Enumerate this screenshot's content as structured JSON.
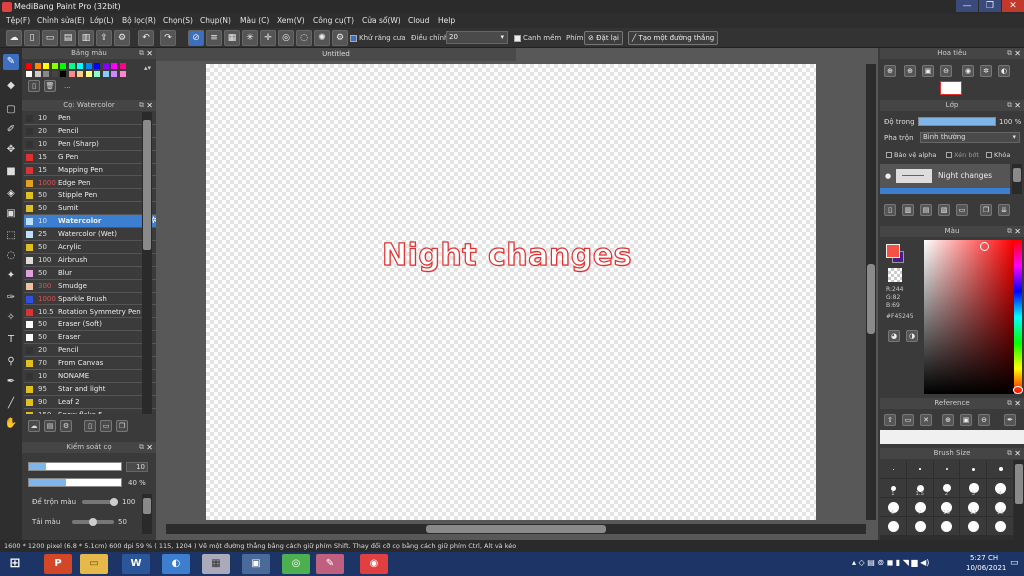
{
  "window": {
    "title": "MediBang Paint Pro (32bit)",
    "controls": [
      "—",
      "❐",
      "✕"
    ]
  },
  "menu": [
    "Tệp(F)",
    "Chỉnh sửa(E)",
    "Lớp(L)",
    "Bộ lọc(R)",
    "Chọn(S)",
    "Chụp(N)",
    "Màu (C)",
    "Xem(V)",
    "Công cụ(T)",
    "Cửa sổ(W)",
    "Cloud",
    "Help"
  ],
  "toolbar": {
    "antialias_label": "Khử răng cưa",
    "adjust_label": "Điều chỉnh",
    "adjust_value": "20",
    "smooth_label": "Canh mềm",
    "key_label": "Phím",
    "reset_label": "Đặt lại",
    "make_line_label": "Tạo một đường thẳng"
  },
  "palette": {
    "title": "Bảng màu",
    "colors": [
      "#ff0000",
      "#ff8800",
      "#ffff00",
      "#88ff00",
      "#00ff00",
      "#00ff88",
      "#00ffff",
      "#0088ff",
      "#0000ff",
      "#8800ff",
      "#ff00ff",
      "#ff0088",
      "#ffffff",
      "#cccccc",
      "#888888",
      "#444444",
      "#000000",
      "#ff8888",
      "#ffcc88",
      "#ffff88",
      "#88ffcc",
      "#88ccff",
      "#cc88ff",
      "#ff88cc"
    ],
    "extra": "..."
  },
  "brush_panel": {
    "title": "Cọ: Watercolor",
    "brushes": [
      {
        "size": "10",
        "name": "Pen",
        "color": "#333333",
        "red": false
      },
      {
        "size": "20",
        "name": "Pencil",
        "color": "#333333",
        "red": false
      },
      {
        "size": "10",
        "name": "Pen (Sharp)",
        "color": "#333333",
        "red": false
      },
      {
        "size": "15",
        "name": "G Pen",
        "color": "#e03030",
        "red": false
      },
      {
        "size": "15",
        "name": "Mapping Pen",
        "color": "#e03030",
        "red": false
      },
      {
        "size": "1000",
        "name": "Edge Pen",
        "color": "#e0a020",
        "red": true
      },
      {
        "size": "50",
        "name": "Stipple Pen",
        "color": "#e0c020",
        "red": false
      },
      {
        "size": "50",
        "name": "Sumit",
        "color": "#e0c020",
        "red": false
      },
      {
        "size": "10",
        "name": "Watercolor",
        "color": "#bfe0ff",
        "red": false
      },
      {
        "size": "25",
        "name": "Watercolor (Wet)",
        "color": "#bfe0ff",
        "red": false
      },
      {
        "size": "50",
        "name": "Acrylic",
        "color": "#e0c020",
        "red": false
      },
      {
        "size": "100",
        "name": "Airbrush",
        "color": "#dddddd",
        "red": false
      },
      {
        "size": "50",
        "name": "Blur",
        "color": "#e0a0e0",
        "red": false
      },
      {
        "size": "300",
        "name": "Smudge",
        "color": "#f0c0a0",
        "red": true
      },
      {
        "size": "1000",
        "name": "Sparkle Brush",
        "color": "#3050e0",
        "red": true
      },
      {
        "size": "10.5",
        "name": "Rotation Symmetry Pen",
        "color": "#e03030",
        "red": false
      },
      {
        "size": "50",
        "name": "Eraser (Soft)",
        "color": "#ffffff",
        "red": false
      },
      {
        "size": "50",
        "name": "Eraser",
        "color": "#ffffff",
        "red": false
      },
      {
        "size": "20",
        "name": "Pencil",
        "color": "#333333",
        "red": false
      },
      {
        "size": "70",
        "name": "From Canvas",
        "color": "#e0c020",
        "red": false
      },
      {
        "size": "10",
        "name": "NONAME",
        "color": "#333333",
        "red": false
      },
      {
        "size": "95",
        "name": "Star and light",
        "color": "#e0c020",
        "red": false
      },
      {
        "size": "90",
        "name": "Leaf 2",
        "color": "#e0c020",
        "red": false
      },
      {
        "size": "150",
        "name": "Snow flake 5",
        "color": "#e0c020",
        "red": false
      }
    ],
    "selected_index": 8
  },
  "brush_control": {
    "title": "Kiểm soát cọ",
    "size_value": "10",
    "size_fraction": 0.18,
    "opacity_value": "40 %",
    "opacity_fraction": 0.4,
    "mix_label": "Để trộn màu",
    "mix_value": "100",
    "mix_fraction": 1.0,
    "reload_label": "Tải màu",
    "reload_value": "50",
    "reload_fraction": 0.5
  },
  "canvas": {
    "tab_title": "Untitled",
    "text": "Night changes"
  },
  "navigator": {
    "title": "Hoa tiêu"
  },
  "layers": {
    "title": "Lớp",
    "opacity_label": "Độ trong",
    "opacity_value": "100 %",
    "opacity_fraction": 1.0,
    "blend_label": "Pha trộn",
    "blend_value": "Bình thường",
    "protect_alpha": "Bảo vệ alpha",
    "clipping": "Xén bớt",
    "lock": "Khóa",
    "items": [
      {
        "name": "Night changes"
      }
    ]
  },
  "color_panel": {
    "title": "Màu",
    "r": "R:244",
    "g": "G:82",
    "b": "B:69",
    "hex": "#F45245",
    "current_color": "#F45245"
  },
  "reference": {
    "title": "Reference"
  },
  "brush_size": {
    "title": "Brush Size",
    "labels": [
      "1",
      "1.5",
      "2",
      "3",
      "4",
      "5",
      "7",
      "10",
      "12",
      "15"
    ]
  },
  "statusbar": {
    "text": "1600 * 1200 pixel  (6.8 * 5.1cm)  600 dpi  59 %  ( 115, 1204 )  Vẽ một đường thẳng bằng cách giữ phím Shift. Thay đổi cỡ cọ bằng cách giữ phím Ctrl, Alt và kéo"
  },
  "taskbar": {
    "time": "5:27 CH",
    "date": "10/06/2021"
  }
}
